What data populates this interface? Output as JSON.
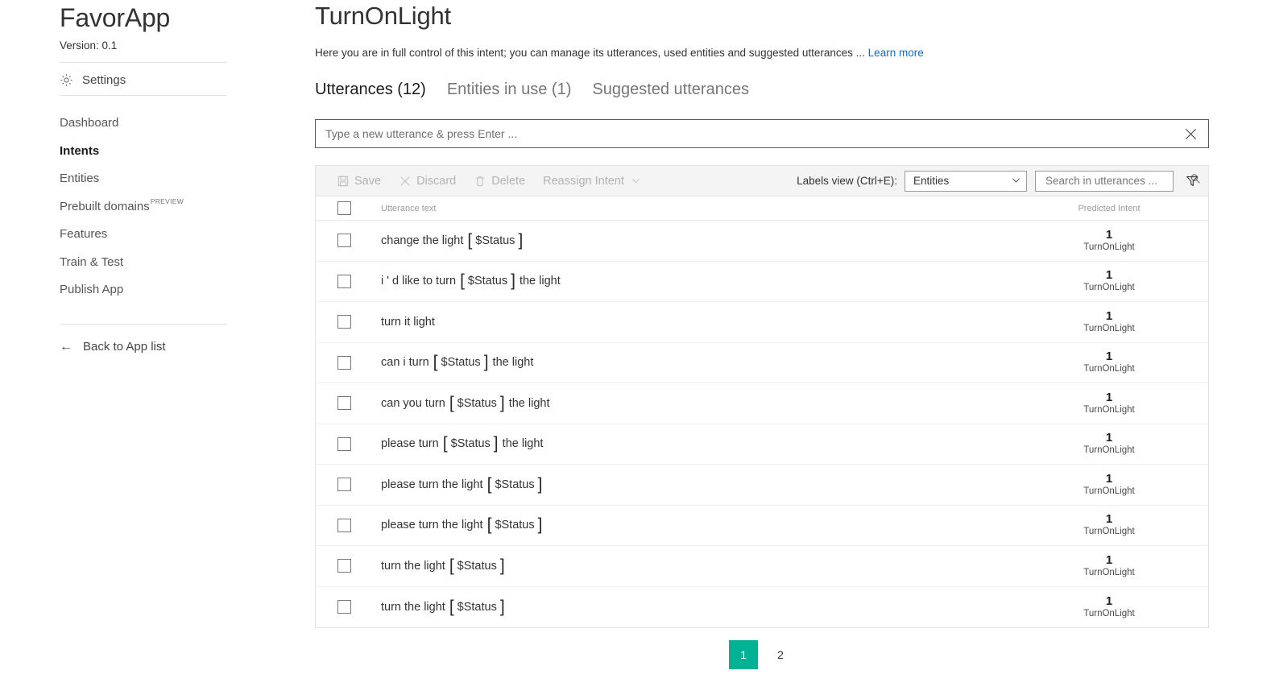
{
  "sidebar": {
    "app_title": "FavorApp",
    "version_label": "Version:  0.1",
    "settings_label": "Settings",
    "settings_icon": "gear-icon",
    "items": [
      {
        "label": "Dashboard",
        "active": false
      },
      {
        "label": "Intents",
        "active": true
      },
      {
        "label": "Entities",
        "active": false
      },
      {
        "label": "Prebuilt domains",
        "badge": "PREVIEW",
        "active": false
      },
      {
        "label": "Features",
        "active": false
      },
      {
        "label": "Train & Test",
        "active": false
      },
      {
        "label": "Publish App",
        "active": false
      }
    ],
    "back_link": "Back to App list",
    "back_icon": "arrow-left-icon"
  },
  "main": {
    "page_title": "TurnOnLight",
    "description": "Here you are in full control of this intent; you can manage its utterances, used entities and suggested utterances ...",
    "learn_more": "Learn more",
    "tabs": [
      {
        "label": "Utterances (12)",
        "active": true
      },
      {
        "label": "Entities in use (1)",
        "active": false
      },
      {
        "label": "Suggested utterances",
        "active": false
      }
    ],
    "new_utterance": {
      "value": "",
      "placeholder": "Type a new utterance & press Enter ...",
      "clear_icon": "close-icon"
    },
    "toolbar": {
      "save_label": "Save",
      "save_icon": "save-icon",
      "discard_label": "Discard",
      "discard_icon": "close-icon",
      "delete_label": "Delete",
      "delete_icon": "trash-icon",
      "reassign_label": "Reassign Intent",
      "reassign_icon": "chevron-down-icon",
      "labels_view_label": "Labels view (Ctrl+E):",
      "labels_view_value": "Entities",
      "labels_view_icon": "chevron-down-icon",
      "search_value": "",
      "search_placeholder": "Search in utterances ...",
      "search_icon": "search-icon",
      "filter_icon": "filter-icon"
    },
    "table": {
      "columns": {
        "utterance": "Utterance text",
        "predicted_intent": "Predicted Intent"
      },
      "rows": [
        {
          "pre": "change the light ",
          "entity": "$Status",
          "post": "",
          "score": "1",
          "intent": "TurnOnLight"
        },
        {
          "pre": "i ' d like to turn ",
          "entity": "$Status",
          "post": " the light",
          "score": "1",
          "intent": "TurnOnLight"
        },
        {
          "pre": "turn it light",
          "entity": "",
          "post": "",
          "score": "1",
          "intent": "TurnOnLight"
        },
        {
          "pre": "can i turn ",
          "entity": "$Status",
          "post": " the light",
          "score": "1",
          "intent": "TurnOnLight"
        },
        {
          "pre": "can you turn ",
          "entity": "$Status",
          "post": " the light",
          "score": "1",
          "intent": "TurnOnLight"
        },
        {
          "pre": "please turn ",
          "entity": "$Status",
          "post": " the light",
          "score": "1",
          "intent": "TurnOnLight"
        },
        {
          "pre": "please turn the light ",
          "entity": "$Status",
          "post": "",
          "score": "1",
          "intent": "TurnOnLight"
        },
        {
          "pre": "please turn the light ",
          "entity": "$Status",
          "post": "",
          "score": "1",
          "intent": "TurnOnLight"
        },
        {
          "pre": "turn the light ",
          "entity": "$Status",
          "post": "",
          "score": "1",
          "intent": "TurnOnLight"
        },
        {
          "pre": "turn the light ",
          "entity": "$Status",
          "post": "",
          "score": "1",
          "intent": "TurnOnLight"
        }
      ]
    },
    "pagination": {
      "pages": [
        {
          "label": "1",
          "active": true
        },
        {
          "label": "2",
          "active": false
        }
      ]
    }
  },
  "colors": {
    "accent_teal": "#00b294",
    "link_blue": "#0f6cbd",
    "toolbar_bg": "#f4f4f4",
    "border": "#e3e3e3"
  }
}
